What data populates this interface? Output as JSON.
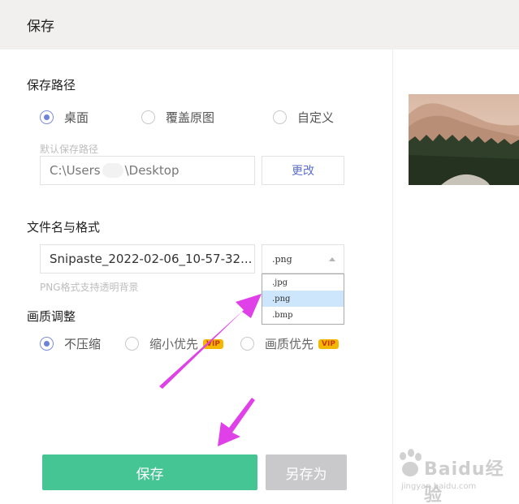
{
  "header": {
    "title": "保存"
  },
  "save_path": {
    "title": "保存路径",
    "options": [
      {
        "label": "桌面",
        "checked": true
      },
      {
        "label": "覆盖原图",
        "checked": false
      },
      {
        "label": "自定义",
        "checked": false
      }
    ],
    "hint": "默认保存路径",
    "path_prefix": "C:\\Users",
    "path_suffix": "\\Desktop",
    "change_label": "更改"
  },
  "file_format": {
    "title": "文件名与格式",
    "filename": "Snipaste_2022-02-06_10-57-32...",
    "selected_format": ".png",
    "hint": "PNG格式支持透明背景",
    "dropdown_options": [
      ".jpg",
      ".png",
      ".bmp"
    ],
    "dropdown_selected_index": 1
  },
  "quality": {
    "title": "画质调整",
    "options": [
      {
        "label": "不压缩",
        "checked": true,
        "vip": false
      },
      {
        "label": "缩小优先",
        "checked": false,
        "vip": true
      },
      {
        "label": "画质优先",
        "checked": false,
        "vip": true
      }
    ],
    "vip_label": "VIP"
  },
  "actions": {
    "save_label": "保存",
    "save_as_label": "另存为"
  },
  "watermark": {
    "brand": "Baidu经验",
    "url": "jingyan.baidu.com"
  },
  "colors": {
    "primary": "#45c494",
    "secondary_button": "#c9c9cc",
    "radio_checked": "#6f82d8",
    "arrow": "#e040e8",
    "header_bg": "#f2f0ef",
    "vip_badge": "#f5b800"
  }
}
